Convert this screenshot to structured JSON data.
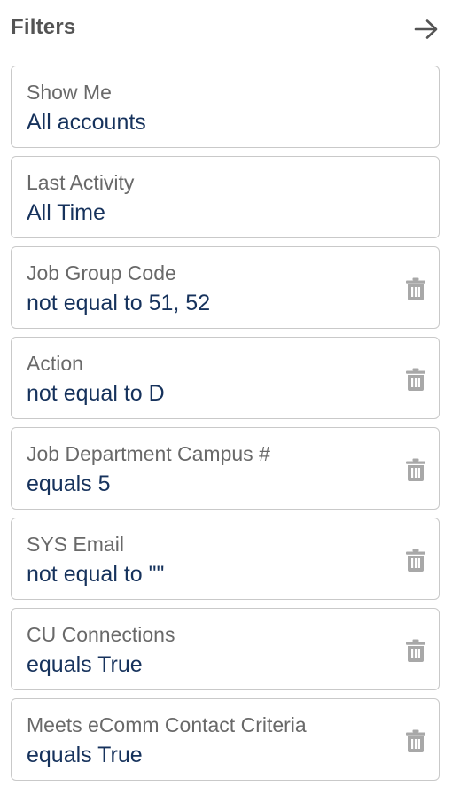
{
  "header": {
    "title": "Filters",
    "collapse_icon": "arrow-right-icon"
  },
  "colors": {
    "title": "#545454",
    "label": "#696969",
    "value": "#16325c",
    "border": "#c9c9c9",
    "icon": "#a8a8a8"
  },
  "filters": [
    {
      "label": "Show Me",
      "value": "All accounts",
      "deletable": false
    },
    {
      "label": "Last Activity",
      "value": "All Time",
      "deletable": false
    },
    {
      "label": "Job Group Code",
      "value": "not equal to 51, 52",
      "deletable": true,
      "delete_icon": "trash-icon"
    },
    {
      "label": "Action",
      "value": "not equal to D",
      "deletable": true,
      "delete_icon": "trash-icon"
    },
    {
      "label": "Job Department Campus #",
      "value": "equals 5",
      "deletable": true,
      "delete_icon": "trash-icon"
    },
    {
      "label": "SYS Email",
      "value": "not equal to \"\"",
      "deletable": true,
      "delete_icon": "trash-icon"
    },
    {
      "label": "CU Connections",
      "value": "equals True",
      "deletable": true,
      "delete_icon": "trash-icon"
    },
    {
      "label": "Meets eComm Contact Criteria",
      "value": "equals True",
      "deletable": true,
      "delete_icon": "trash-icon"
    }
  ]
}
